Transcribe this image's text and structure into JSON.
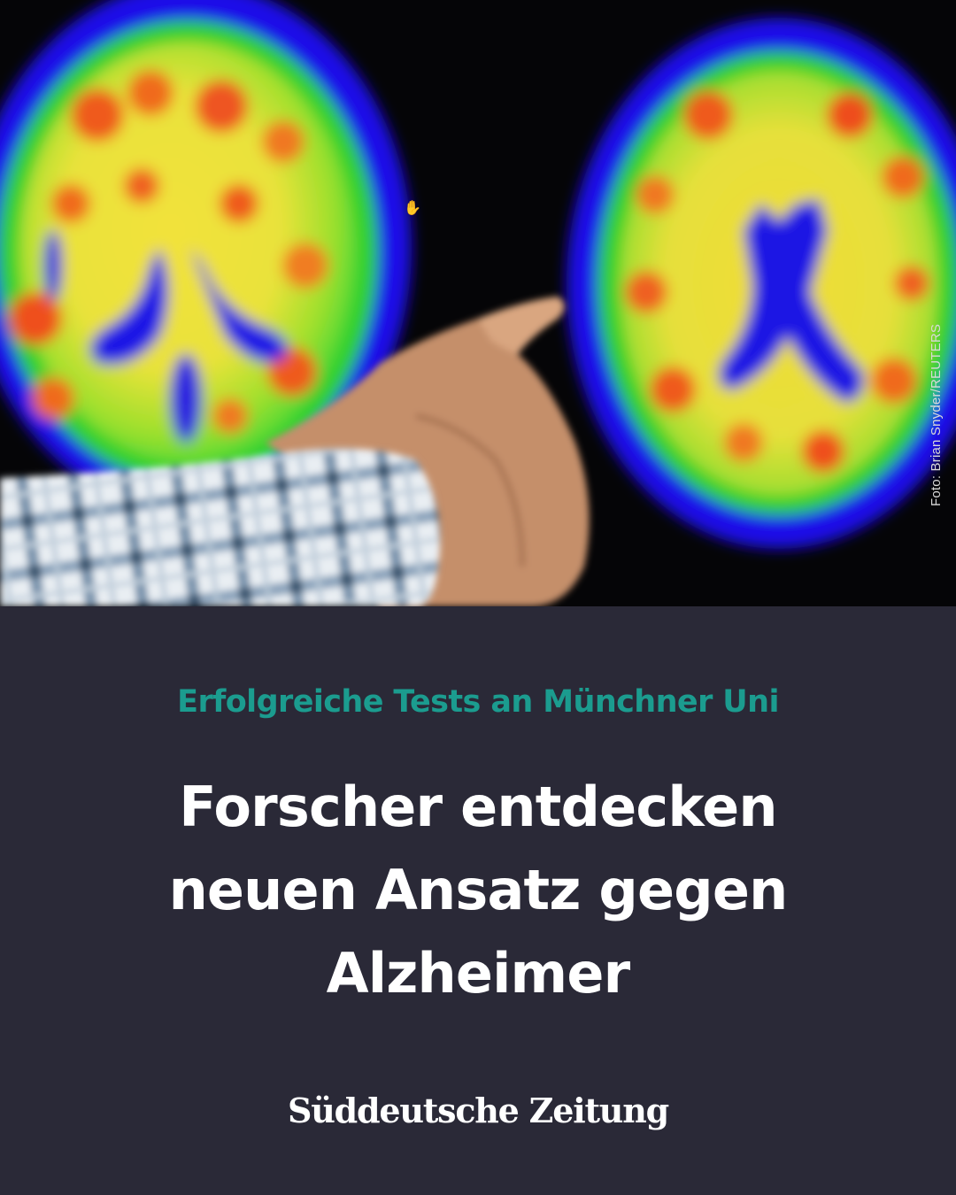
{
  "photo": {
    "subject": "brain-pet-scan",
    "credit": "Foto: Brian Snyder/REUTERS"
  },
  "kicker": "Erfolgreiche Tests an Münchner Uni",
  "headline": {
    "line1": "Forscher entdecken",
    "line2": "neuen Ansatz gegen",
    "line3": "Alzheimer"
  },
  "brand": {
    "name": "Süddeutsche Zeitung"
  },
  "colors": {
    "background": "#2a2937",
    "kicker": "#1b9c8f",
    "headline": "#ffffff"
  }
}
